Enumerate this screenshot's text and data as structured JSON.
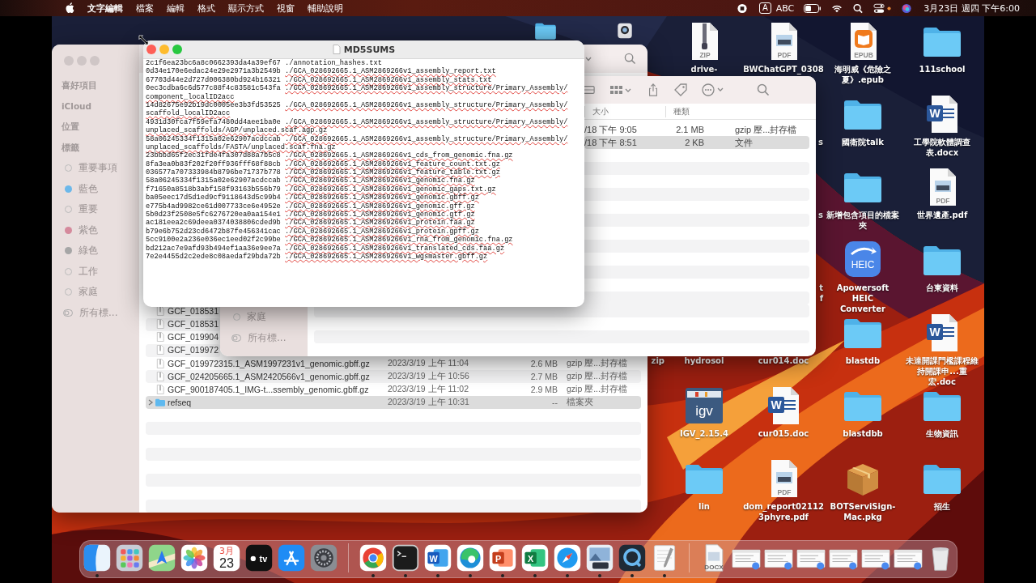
{
  "menu_bar": {
    "menus": [
      {
        "label": "文字編輯",
        "kind": "app"
      },
      {
        "label": "檔案",
        "kind": "menu"
      },
      {
        "label": "編輯",
        "kind": "menu"
      },
      {
        "label": "格式",
        "kind": "menu"
      },
      {
        "label": "顯示方式",
        "kind": "menu"
      },
      {
        "label": "視窗",
        "kind": "menu"
      },
      {
        "label": "輔助說明",
        "kind": "menu"
      }
    ],
    "input_badge": "A",
    "input_name": "ABC",
    "clock": "3月23日 週四 下午6:00"
  },
  "desktop": {
    "rows": [
      [
        {
          "kind": "folder"
        },
        {
          "kind": "app"
        },
        {
          "kind": "zip",
          "label": "drive-",
          "badge": "ZIP"
        },
        {
          "kind": "pdf",
          "label": "BWChatGPT_0308",
          "badge": "PDF"
        },
        {
          "kind": "epub",
          "label": "海明威《危險之夏》.epub",
          "badge": "EPUB"
        },
        {
          "kind": "folder",
          "label": "111school"
        }
      ],
      [
        {
          "kind": "none"
        },
        {
          "kind": "none"
        },
        {
          "kind": "none"
        },
        {
          "kind": "tail",
          "label": "s"
        },
        {
          "kind": "folder",
          "label": "國衛院talk"
        },
        {
          "kind": "word",
          "label": "工學院軟體調查表.docx",
          "badge": "W"
        }
      ],
      [
        {
          "kind": "none"
        },
        {
          "kind": "none"
        },
        {
          "kind": "none"
        },
        {
          "kind": "tail",
          "label": "s"
        },
        {
          "kind": "folder",
          "label": "新增包含項目的檔案夾"
        },
        {
          "kind": "pdf",
          "label": "世界遺產.pdf",
          "badge": "PDF"
        }
      ],
      [
        {
          "kind": "none"
        },
        {
          "kind": "none"
        },
        {
          "kind": "none"
        },
        {
          "kind": "tail",
          "label": "t\nf"
        },
        {
          "kind": "heic",
          "label": "Apowersoft HEIC\nConverter",
          "badge": "HEIC"
        },
        {
          "kind": "folder",
          "label": "台東資料"
        }
      ],
      [
        {
          "kind": "none"
        },
        {
          "kind": "tail",
          "label": "zip"
        },
        {
          "kind": "covered",
          "label": "hydrosol"
        },
        {
          "kind": "covered",
          "label": "cur014.doc"
        },
        {
          "kind": "folder",
          "label": "blastdb"
        },
        {
          "kind": "word",
          "label": "未達開課門檻課程維持開課申...重宏.doc",
          "badge": "W"
        }
      ],
      [
        {
          "kind": "none"
        },
        {
          "kind": "none"
        },
        {
          "kind": "igv",
          "label": "IGV_2.15.4",
          "badge": "igv"
        },
        {
          "kind": "word",
          "label": "cur015.doc",
          "badge": "W"
        },
        {
          "kind": "folder",
          "label": "blastdbb"
        },
        {
          "kind": "folder",
          "label": "生物資訊"
        }
      ],
      [
        {
          "kind": "none"
        },
        {
          "kind": "none"
        },
        {
          "kind": "folder",
          "label": "lin"
        },
        {
          "kind": "pdf",
          "label": "dom_report02112\n3phyre.pdf",
          "badge": "PDF"
        },
        {
          "kind": "pkg",
          "label": "BOTServiSign-\nMac.pkg"
        },
        {
          "kind": "folder",
          "label": "招生"
        }
      ]
    ]
  },
  "finder_back": {
    "sidebar": [
      {
        "kind": "heading",
        "label": "喜好項目"
      },
      {
        "kind": "heading",
        "label": "iCloud"
      },
      {
        "kind": "heading",
        "label": "位置"
      },
      {
        "kind": "heading",
        "label": "標籤"
      },
      {
        "kind": "tag",
        "label": "重要事項"
      },
      {
        "kind": "tag",
        "label": "藍色",
        "color": "#6cb8ea"
      },
      {
        "kind": "tag",
        "label": "重要"
      },
      {
        "kind": "tag",
        "label": "紫色",
        "color": "#d58a9c"
      },
      {
        "kind": "tag",
        "label": "綠色",
        "color": "#a6a6a6"
      },
      {
        "kind": "tag",
        "label": "工作"
      },
      {
        "kind": "tag",
        "label": "家庭"
      },
      {
        "kind": "all-tags",
        "label": "所有標..."
      }
    ],
    "rows": [
      {
        "kind": "file",
        "name": "GCF_018531",
        "selected": false
      },
      {
        "kind": "file",
        "name": "GCF_018531",
        "selected": false
      },
      {
        "kind": "file",
        "name": "GCF_019904",
        "selected": false
      },
      {
        "kind": "file",
        "name": "GCF_019972",
        "selected": false
      },
      {
        "kind": "file",
        "name": "GCF_019972315.1_ASM1997231v1_genomic.gbff.gz",
        "date": "2023/3/19 上午 11:04",
        "size": "2.6 MB",
        "type": "gzip 壓...封存檔",
        "selected": false
      },
      {
        "kind": "file",
        "name": "GCF_024205665.1_ASM2420566v1_genomic.gbff.gz",
        "date": "2023/3/19 上午 10:56",
        "size": "2.7 MB",
        "type": "gzip 壓...封存檔",
        "selected": false
      },
      {
        "kind": "file",
        "name": "GCF_900187405.1_IMG-t...ssembly_genomic.gbff.gz",
        "date": "2023/3/19 上午 11:02",
        "size": "2.9 MB",
        "type": "gzip 壓...封存檔",
        "selected": false
      },
      {
        "kind": "folder",
        "name": "refseq",
        "date": "2023/3/19 上午 10:31",
        "size": "--",
        "type": "檔案夾",
        "selected": true,
        "expanded": false
      }
    ]
  },
  "finder_front": {
    "sidebar": [
      {
        "kind": "tag",
        "label": "家庭"
      },
      {
        "kind": "all-tags",
        "label": "所有標..."
      }
    ],
    "columns": [
      "大小",
      "種類"
    ],
    "rows": [
      {
        "date": "/18 下午 9:05",
        "size": "2.1 MB",
        "type": "gzip 壓...封存檔",
        "selected": false
      },
      {
        "date": "/18 下午 8:51",
        "size": "2 KB",
        "type": "文件",
        "selected": true
      }
    ]
  },
  "text_window": {
    "title": "MD5SUMS",
    "lines": [
      {
        "kind": "entry",
        "hash": "2c1f6ea23bc6a8c0662393da4a39ef67",
        "path": "./annotation_hashes.txt",
        "flagged": false
      },
      {
        "kind": "entry",
        "hash": "0d34e170e6edac24e29e2971a3b2549b",
        "path": "./GCA_028692665.1_ASM2869266v1_assembly_report.txt",
        "flagged": true
      },
      {
        "kind": "entry",
        "hash": "67703d44e2d727d006380bd924b16321",
        "path": "./GCA_028692665.1_ASM2869266v1_assembly_stats.txt",
        "flagged": true
      },
      {
        "kind": "entry",
        "hash": "0ec3cdba6c6d577c88f4c83581c543fa",
        "path": "./GCA_028692665.1_ASM2869266v1_assembly_structure/Primary_Assembly/",
        "flagged": true
      },
      {
        "kind": "wrap",
        "text": "component_localID2acc",
        "flagged": true
      },
      {
        "kind": "entry",
        "hash": "14d82675e92b19dc0005ee3b3fd53525",
        "path": "./GCA_028692665.1_ASM2869266v1_assembly_structure/Primary_Assembly/",
        "flagged": true
      },
      {
        "kind": "wrap",
        "text": "scaffold_localID2acc",
        "flagged": true
      },
      {
        "kind": "entry",
        "hash": "4931d30fca7f59efa7480dd4aee1ba0e",
        "path": "./GCA_028692665.1_ASM2869266v1_assembly_structure/Primary_Assembly/",
        "flagged": true
      },
      {
        "kind": "wrap",
        "text": "unplaced_scaffolds/AGP/unplaced.scaf.agp.gz",
        "flagged": true
      },
      {
        "kind": "entry",
        "hash": "58a06245334f1315a02e62907acdccab",
        "path": "./GCA_028692665.1_ASM2869266v1_assembly_structure/Primary_Assembly/",
        "flagged": true
      },
      {
        "kind": "wrap",
        "text": "unplaced_scaffolds/FASTA/unplaced.scaf.fna.gz",
        "flagged": true
      },
      {
        "kind": "entry",
        "hash": "23bbbd65f2ec31fde4fa307d88a7b5c8",
        "path": "./GCA_028692665.1_ASM2869266v1_cds_from_genomic.fna.gz",
        "flagged": true
      },
      {
        "kind": "entry",
        "hash": "8fa3ea0b83f202f20ff936fff68f88cb",
        "path": "./GCA_028692665.1_ASM2869266v1_feature_count.txt.gz",
        "flagged": true
      },
      {
        "kind": "entry",
        "hash": "036577a707333984b8796be71737b778",
        "path": "./GCA_028692665.1_ASM2869266v1_feature_table.txt.gz",
        "flagged": true
      },
      {
        "kind": "entry",
        "hash": "58a06245334f1315a02e62907acdccab",
        "path": "./GCA_028692665.1_ASM2869266v1_genomic.fna.gz",
        "flagged": true
      },
      {
        "kind": "entry",
        "hash": "f71650a8518b3abf158f93163b556b79",
        "path": "./GCA_028692665.1_ASM2869266v1_genomic_gaps.txt.gz",
        "flagged": true
      },
      {
        "kind": "entry",
        "hash": "ba05eec17d5d1ed9cf9118643d5c99b4",
        "path": "./GCA_028692665.1_ASM2869266v1_genomic.gbff.gz",
        "flagged": true
      },
      {
        "kind": "entry",
        "hash": "e775b4ad9982ce61d007733ce6e4952e",
        "path": "./GCA_028692665.1_ASM2869266v1_genomic.gff.gz",
        "flagged": true
      },
      {
        "kind": "entry",
        "hash": "5b0d23f2508e5fc6276720ea0aa154e1",
        "path": "./GCA_028692665.1_ASM2869266v1_genomic.gtf.gz",
        "flagged": true
      },
      {
        "kind": "entry",
        "hash": "ac181eea2c69deea0374038806cded9b",
        "path": "./GCA_028692665.1_ASM2869266v1_protein.faa.gz",
        "flagged": true
      },
      {
        "kind": "entry",
        "hash": "b79e6b752d23cd6472b87fe456341cac",
        "path": "./GCA_028692665.1_ASM2869266v1_protein.gpff.gz",
        "flagged": true
      },
      {
        "kind": "entry",
        "hash": "5cc9100e2a236e036ec1eed02f2c99be",
        "path": "./GCA_028692665.1_ASM2869266v1_rna_from_genomic.fna.gz",
        "flagged": true
      },
      {
        "kind": "entry",
        "hash": "bd212ac7e9afd93b494ef1aa36e9ee7a",
        "path": "./GCA_028692665.1_ASM2869266v1_translated_cds.faa.gz",
        "flagged": true
      },
      {
        "kind": "entry",
        "hash": "7e2e4455d2c2ede8c08aedaf29bda72b",
        "path": "./GCA_028692665.1_ASM2869266v1_wgsmaster.gbff.gz",
        "flagged": true
      }
    ]
  },
  "dock": {
    "items": [
      {
        "kind": "finder",
        "running": true
      },
      {
        "kind": "launchpad",
        "running": false
      },
      {
        "kind": "maps",
        "running": false
      },
      {
        "kind": "photos",
        "running": false
      },
      {
        "kind": "calendar",
        "month": "3月",
        "day": "23",
        "running": false
      },
      {
        "kind": "tv",
        "badge": "tv",
        "running": false
      },
      {
        "kind": "appstore",
        "running": false
      },
      {
        "kind": "settings",
        "running": false
      },
      {
        "kind": "separator"
      },
      {
        "kind": "chrome",
        "running": true
      },
      {
        "kind": "terminal",
        "running": true
      },
      {
        "kind": "word",
        "badge": "W",
        "running": true
      },
      {
        "kind": "edge",
        "running": true
      },
      {
        "kind": "powerpoint",
        "badge": "P",
        "running": true
      },
      {
        "kind": "excel",
        "badge": "X",
        "running": true
      },
      {
        "kind": "safari",
        "running": true
      },
      {
        "kind": "preview",
        "running": true
      },
      {
        "kind": "quicktime",
        "running": true
      },
      {
        "kind": "textedit",
        "running": true
      },
      {
        "kind": "separator"
      },
      {
        "kind": "docfile",
        "badge": "DOCX"
      },
      {
        "kind": "thumb"
      },
      {
        "kind": "thumb"
      },
      {
        "kind": "thumb"
      },
      {
        "kind": "thumb"
      },
      {
        "kind": "thumb"
      },
      {
        "kind": "thumb"
      },
      {
        "kind": "trash"
      }
    ]
  }
}
